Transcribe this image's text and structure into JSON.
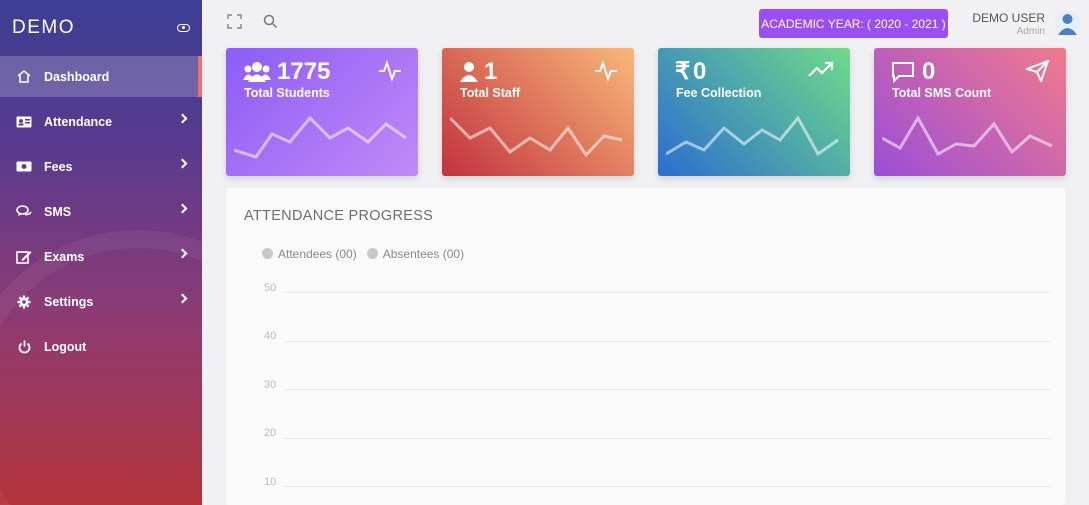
{
  "brand": {
    "name": "DEMO"
  },
  "sidebar": {
    "items": [
      {
        "label": "Dashboard",
        "icon": "home-icon"
      },
      {
        "label": "Attendance",
        "icon": "id-card-icon"
      },
      {
        "label": "Fees",
        "icon": "money-icon"
      },
      {
        "label": "SMS",
        "icon": "chat-icon"
      },
      {
        "label": "Exams",
        "icon": "edit-icon"
      },
      {
        "label": "Settings",
        "icon": "gear-icon"
      },
      {
        "label": "Logout",
        "icon": "power-icon"
      }
    ]
  },
  "header": {
    "academic_year": "ACADEMIC YEAR: ( 2020 - 2021 )",
    "user_name": "DEMO USER",
    "user_role": "Admin"
  },
  "cards": [
    {
      "value": "1775",
      "label": "Total Students",
      "color_from": "#8d5cf5",
      "color_to": "#c08af6"
    },
    {
      "value": "1",
      "label": "Total Staff",
      "color_from": "#c2323f",
      "color_to": "#f8b878"
    },
    {
      "value": "0",
      "label": "Fee Collection",
      "color_from": "#2b6dd0",
      "color_to": "#6edb8a"
    },
    {
      "value": "0",
      "label": "Total SMS Count",
      "color_from": "#9b4dd8",
      "color_to": "#f07a8d"
    }
  ],
  "attendance": {
    "title": "ATTENDANCE PROGRESS",
    "legend": [
      "Attendees (00)",
      "Absentees (00)"
    ],
    "y_ticks": [
      "50",
      "40",
      "30",
      "20",
      "10"
    ]
  }
}
